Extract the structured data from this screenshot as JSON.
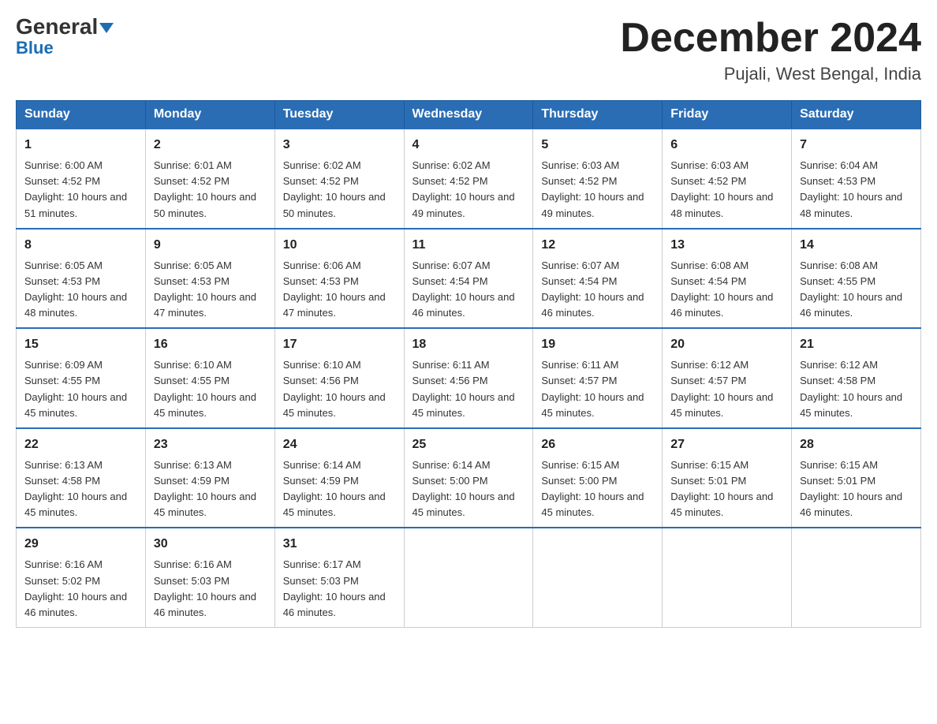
{
  "header": {
    "logo_line1": "General",
    "logo_line2": "Blue",
    "month_title": "December 2024",
    "location": "Pujali, West Bengal, India"
  },
  "days_of_week": [
    "Sunday",
    "Monday",
    "Tuesday",
    "Wednesday",
    "Thursday",
    "Friday",
    "Saturday"
  ],
  "weeks": [
    [
      {
        "day": "1",
        "sunrise": "6:00 AM",
        "sunset": "4:52 PM",
        "daylight": "10 hours and 51 minutes."
      },
      {
        "day": "2",
        "sunrise": "6:01 AM",
        "sunset": "4:52 PM",
        "daylight": "10 hours and 50 minutes."
      },
      {
        "day": "3",
        "sunrise": "6:02 AM",
        "sunset": "4:52 PM",
        "daylight": "10 hours and 50 minutes."
      },
      {
        "day": "4",
        "sunrise": "6:02 AM",
        "sunset": "4:52 PM",
        "daylight": "10 hours and 49 minutes."
      },
      {
        "day": "5",
        "sunrise": "6:03 AM",
        "sunset": "4:52 PM",
        "daylight": "10 hours and 49 minutes."
      },
      {
        "day": "6",
        "sunrise": "6:03 AM",
        "sunset": "4:52 PM",
        "daylight": "10 hours and 48 minutes."
      },
      {
        "day": "7",
        "sunrise": "6:04 AM",
        "sunset": "4:53 PM",
        "daylight": "10 hours and 48 minutes."
      }
    ],
    [
      {
        "day": "8",
        "sunrise": "6:05 AM",
        "sunset": "4:53 PM",
        "daylight": "10 hours and 48 minutes."
      },
      {
        "day": "9",
        "sunrise": "6:05 AM",
        "sunset": "4:53 PM",
        "daylight": "10 hours and 47 minutes."
      },
      {
        "day": "10",
        "sunrise": "6:06 AM",
        "sunset": "4:53 PM",
        "daylight": "10 hours and 47 minutes."
      },
      {
        "day": "11",
        "sunrise": "6:07 AM",
        "sunset": "4:54 PM",
        "daylight": "10 hours and 46 minutes."
      },
      {
        "day": "12",
        "sunrise": "6:07 AM",
        "sunset": "4:54 PM",
        "daylight": "10 hours and 46 minutes."
      },
      {
        "day": "13",
        "sunrise": "6:08 AM",
        "sunset": "4:54 PM",
        "daylight": "10 hours and 46 minutes."
      },
      {
        "day": "14",
        "sunrise": "6:08 AM",
        "sunset": "4:55 PM",
        "daylight": "10 hours and 46 minutes."
      }
    ],
    [
      {
        "day": "15",
        "sunrise": "6:09 AM",
        "sunset": "4:55 PM",
        "daylight": "10 hours and 45 minutes."
      },
      {
        "day": "16",
        "sunrise": "6:10 AM",
        "sunset": "4:55 PM",
        "daylight": "10 hours and 45 minutes."
      },
      {
        "day": "17",
        "sunrise": "6:10 AM",
        "sunset": "4:56 PM",
        "daylight": "10 hours and 45 minutes."
      },
      {
        "day": "18",
        "sunrise": "6:11 AM",
        "sunset": "4:56 PM",
        "daylight": "10 hours and 45 minutes."
      },
      {
        "day": "19",
        "sunrise": "6:11 AM",
        "sunset": "4:57 PM",
        "daylight": "10 hours and 45 minutes."
      },
      {
        "day": "20",
        "sunrise": "6:12 AM",
        "sunset": "4:57 PM",
        "daylight": "10 hours and 45 minutes."
      },
      {
        "day": "21",
        "sunrise": "6:12 AM",
        "sunset": "4:58 PM",
        "daylight": "10 hours and 45 minutes."
      }
    ],
    [
      {
        "day": "22",
        "sunrise": "6:13 AM",
        "sunset": "4:58 PM",
        "daylight": "10 hours and 45 minutes."
      },
      {
        "day": "23",
        "sunrise": "6:13 AM",
        "sunset": "4:59 PM",
        "daylight": "10 hours and 45 minutes."
      },
      {
        "day": "24",
        "sunrise": "6:14 AM",
        "sunset": "4:59 PM",
        "daylight": "10 hours and 45 minutes."
      },
      {
        "day": "25",
        "sunrise": "6:14 AM",
        "sunset": "5:00 PM",
        "daylight": "10 hours and 45 minutes."
      },
      {
        "day": "26",
        "sunrise": "6:15 AM",
        "sunset": "5:00 PM",
        "daylight": "10 hours and 45 minutes."
      },
      {
        "day": "27",
        "sunrise": "6:15 AM",
        "sunset": "5:01 PM",
        "daylight": "10 hours and 45 minutes."
      },
      {
        "day": "28",
        "sunrise": "6:15 AM",
        "sunset": "5:01 PM",
        "daylight": "10 hours and 46 minutes."
      }
    ],
    [
      {
        "day": "29",
        "sunrise": "6:16 AM",
        "sunset": "5:02 PM",
        "daylight": "10 hours and 46 minutes."
      },
      {
        "day": "30",
        "sunrise": "6:16 AM",
        "sunset": "5:03 PM",
        "daylight": "10 hours and 46 minutes."
      },
      {
        "day": "31",
        "sunrise": "6:17 AM",
        "sunset": "5:03 PM",
        "daylight": "10 hours and 46 minutes."
      },
      null,
      null,
      null,
      null
    ]
  ]
}
